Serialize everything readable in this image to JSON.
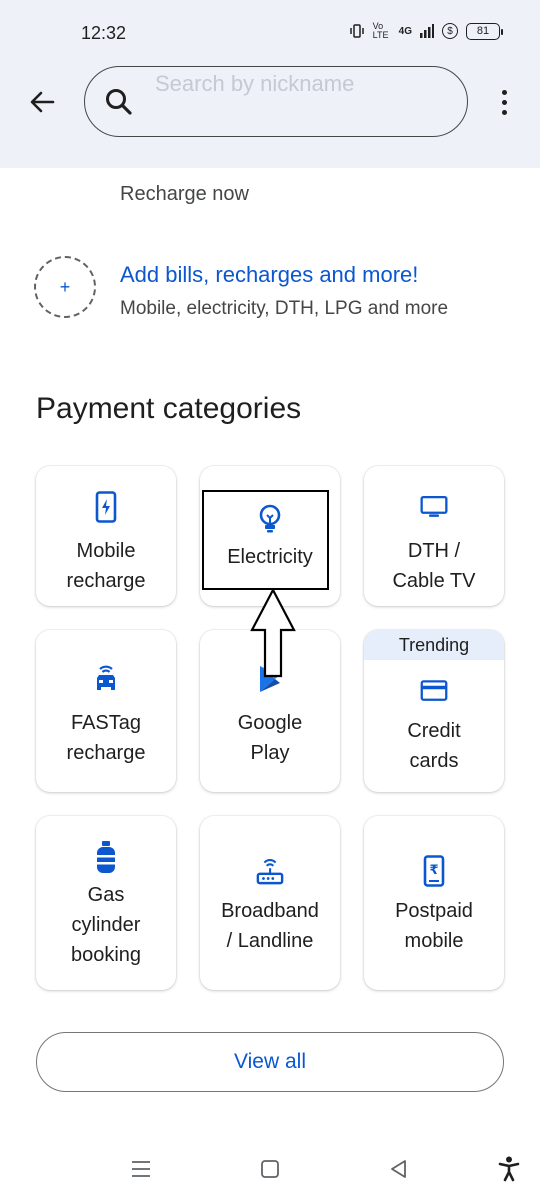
{
  "status_bar": {
    "time": "12:32",
    "network_label": "4G",
    "volte_label": "Vo LTE",
    "battery": "81"
  },
  "header": {
    "search_placeholder": "Search by nickname"
  },
  "recharge_now": "Recharge now",
  "add_bills": {
    "plus": "+",
    "title": "Add bills, recharges and more!",
    "subtitle": "Mobile, electricity, DTH, LPG and more"
  },
  "section_title": "Payment categories",
  "categories": [
    {
      "label": "Mobile\nrecharge",
      "icon": "mobile-recharge-icon"
    },
    {
      "label": "Electricity",
      "icon": "lightbulb-icon"
    },
    {
      "label": "DTH /\nCable TV",
      "icon": "tv-icon"
    },
    {
      "label": "FASTag\nrecharge",
      "icon": "car-icon"
    },
    {
      "label": "Google\nPlay",
      "icon": "google-play-icon"
    },
    {
      "label": "Credit\ncards",
      "icon": "credit-card-icon",
      "tag": "Trending"
    },
    {
      "label": "Gas\ncylinder\nbooking",
      "icon": "gas-cylinder-icon"
    },
    {
      "label": "Broadband\n/ Landline",
      "icon": "router-icon"
    },
    {
      "label": "Postpaid\nmobile",
      "icon": "postpaid-mobile-icon"
    }
  ],
  "view_all": "View all",
  "colors": {
    "accent": "#0b57d0",
    "header_bg": "#eef1f7",
    "trending_bg": "#e6edfb"
  }
}
